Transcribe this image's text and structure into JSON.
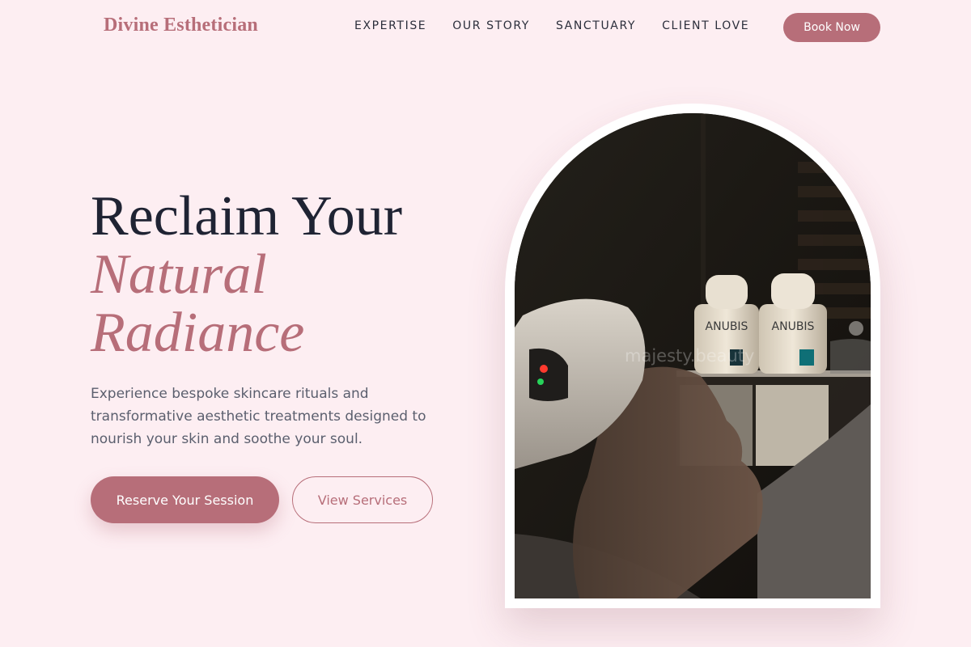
{
  "brand": {
    "name": "Divine Esthetician",
    "accent_color": "#b76e79",
    "background_color": "#fdeef2"
  },
  "nav": {
    "links": [
      "EXPERTISE",
      "OUR STORY",
      "SANCTUARY",
      "CLIENT LOVE"
    ],
    "cta_label": "Book Now"
  },
  "hero": {
    "title_line1": "Reclaim Your",
    "title_line2": "Natural",
    "title_line3": "Radiance",
    "description": "Experience bespoke skincare rituals and transformative aesthetic treatments designed to nourish your skin and soothe your soul.",
    "primary_cta": "Reserve Your Session",
    "secondary_cta": "View Services"
  },
  "image": {
    "subject": "client receiving LED facial treatment beside skincare bottles",
    "bottle_label": "ANUBIS",
    "watermark": "majesty.beauty"
  }
}
